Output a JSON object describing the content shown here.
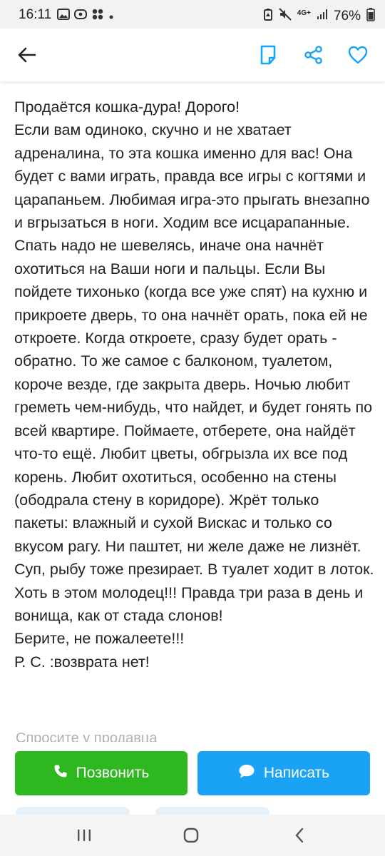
{
  "status_bar": {
    "time": "16:11",
    "battery": "76%",
    "network": "4G+",
    "left_icons": [
      "gallery-icon",
      "messenger-icon",
      "app-icon",
      "dot-icon"
    ],
    "right_icons": [
      "battery-saver-icon",
      "mute-icon",
      "signal-icon",
      "battery-icon"
    ]
  },
  "app_bar": {
    "icons": [
      "back-arrow-icon",
      "note-icon",
      "share-icon",
      "heart-icon"
    ],
    "accent_color": "#1aa3f5"
  },
  "listing": {
    "description": "Продаётся кошка-дура! Дорого!\nЕсли вам одиноко, скучно и не хватает адреналина, то эта кошка именно для вас! Она будет с вами играть, правда все игры с когтями и царапаньем. Любимая игра-это прыгать внезапно и вгрызаться в ноги. Ходим все исцарапанные. Спать надо не шевелясь, иначе она начнёт охотиться на Ваши ноги и пальцы. Если Вы пойдете тихонько (когда все уже спят) на кухню и прикроете дверь, то она начнёт орать, пока ей не откроете. Когда откроете, сразу будет орать - обратно. То же самое с балконом, туалетом, короче везде, где закрыта дверь. Ночью любит греметь чем-нибудь, что найдет, и будет гонять по всей квартире. Поймаете, отберете, она найдёт что-то ещё. Любит цветы, обгрызла их все под корень. Любит охотиться, особенно на стены (ободрала стену в коридоре). Жрёт только пакеты: влажный и сухой Вискас и только со вкусом рагу. Ни паштет, ни желе даже не лизнёт. Суп, рыбу тоже презирает. В туалет ходит в лоток. Хоть в этом молодец!!! Правда три раза в день и вонища, как от стада слонов!\nБерите, не пожалеете!!!\nР. С. :возврата нет!",
    "ask_seller_label": "Спросите у продавца"
  },
  "actions": {
    "call_label": "Позвонить",
    "write_label": "Написать",
    "call_color": "#2db820",
    "write_color": "#1aa3f5"
  },
  "nav_bar": {
    "icons": [
      "recent-apps-icon",
      "home-icon",
      "back-icon"
    ]
  }
}
